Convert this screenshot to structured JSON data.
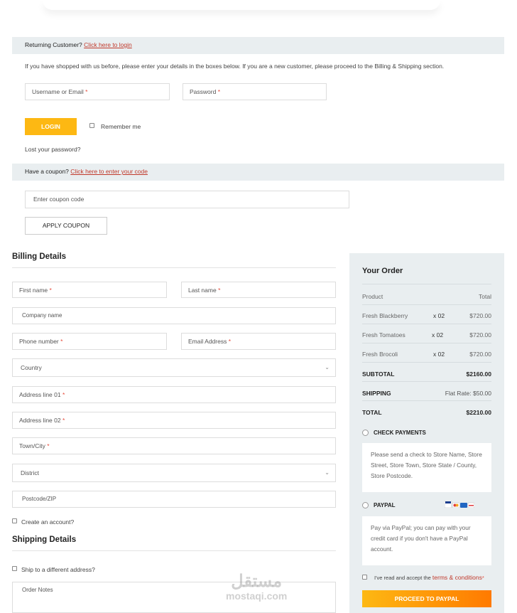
{
  "returning": {
    "text": "Returning Customer?",
    "link": "Click here to login"
  },
  "login_info": "If you have shopped with us before, please enter your details in the boxes below. If you are a new customer, please proceed to the Billing & Shipping section.",
  "login_form": {
    "username_label": "Username or Email",
    "password_label": "Password",
    "required_mark": "*",
    "login_button": "LOGIN",
    "remember_label": "Remember me",
    "lost_password": "Lost your password?"
  },
  "coupon": {
    "text": "Have a coupon?",
    "link": "Click here to enter your code",
    "placeholder": "Enter coupon code",
    "apply_button": "APPLY COUPON"
  },
  "billing": {
    "title": "Billing Details",
    "first_name": "First name",
    "last_name": "Last name",
    "company": "Company name",
    "phone": "Phone number",
    "email": "Email Address",
    "country": "Country",
    "address1": "Address line 01",
    "address2": "Address line 02",
    "town": "Town/City",
    "district": "District",
    "postcode": "Postcode/ZIP",
    "create_account": "Create an account?"
  },
  "shipping": {
    "title": "Shipping Details",
    "ship_different": "Ship to a different address?",
    "order_notes": "Order Notes"
  },
  "order": {
    "title": "Your Order",
    "col_product": "Product",
    "col_total": "Total",
    "items": [
      {
        "name": "Fresh Blackberry",
        "qty": "x 02",
        "total": "$720.00"
      },
      {
        "name": "Fresh Tomatoes",
        "qty": "x 02",
        "total": "$720.00"
      },
      {
        "name": "Fresh Brocoli",
        "qty": "x 02",
        "total": "$720.00"
      }
    ],
    "subtotal_label": "SUBTOTAL",
    "subtotal_value": "$2160.00",
    "shipping_label": "SHIPPING",
    "shipping_value": "Flat Rate: $50.00",
    "total_label": "TOTAL",
    "total_value": "$2210.00",
    "check_payments": "CHECK PAYMENTS",
    "check_desc": "Please send a check to Store Name, Store Street, Store Town, Store State / County, Store Postcode.",
    "paypal": "PAYPAL",
    "paypal_desc": "Pay via PayPal; you can pay with your credit card if you don't have a PayPal account.",
    "terms_text": "I've read and accept the",
    "terms_link": "terms & conditions",
    "proceed_button": "PROCEED TO PAYPAL"
  },
  "watermark": {
    "arabic": "مستقل",
    "latin": "mostaqi.com"
  },
  "colors": {
    "accent": "#fdb813",
    "accent_end": "#ff7a00",
    "link": "#c0392b",
    "panel": "#e9eef0"
  }
}
